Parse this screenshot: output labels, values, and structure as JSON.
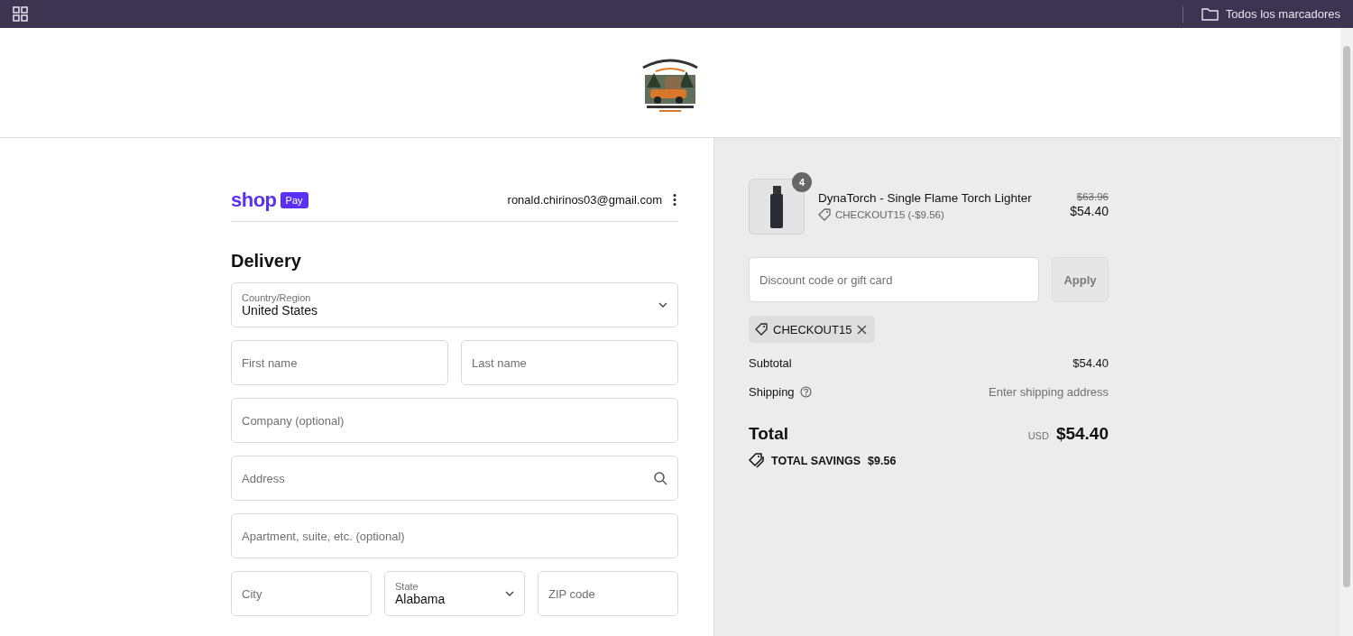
{
  "browser_bar": {
    "bookmarks_label": "Todos los marcadores"
  },
  "shop_pay": {
    "brand": "shop",
    "badge": "Pay",
    "email": "ronald.chirinos03@gmail.com"
  },
  "delivery": {
    "heading": "Delivery",
    "rows": [
      [
        {
          "kind": "select",
          "label": "Country/Region",
          "value": "United States"
        }
      ],
      [
        {
          "kind": "text",
          "placeholder": "First name"
        },
        {
          "kind": "text",
          "placeholder": "Last name"
        }
      ],
      [
        {
          "kind": "text",
          "placeholder": "Company (optional)"
        }
      ],
      [
        {
          "kind": "search",
          "placeholder": "Address"
        }
      ],
      [
        {
          "kind": "text",
          "placeholder": "Apartment, suite, etc. (optional)"
        }
      ],
      [
        {
          "kind": "text",
          "placeholder": "City"
        },
        {
          "kind": "select",
          "label": "State",
          "value": "Alabama"
        },
        {
          "kind": "text",
          "placeholder": "ZIP code"
        }
      ]
    ]
  },
  "summary": {
    "item": {
      "quantity": "4",
      "name": "DynaTorch - Single Flame Torch Lighter",
      "discount": "CHECKOUT15 (-$9.56)",
      "original_price": "$63.96",
      "price": "$54.40"
    },
    "discount_field": {
      "placeholder": "Discount code or gift card"
    },
    "apply_button": {
      "label": "Apply",
      "disabled": true
    },
    "applied_codes": [
      {
        "code": "CHECKOUT15"
      }
    ],
    "lines": [
      {
        "kind": "amount",
        "label": "Subtotal",
        "value": "$54.40"
      },
      {
        "kind": "pending",
        "label": "Shipping",
        "value": "Enter shipping address"
      }
    ],
    "total": {
      "label": "Total",
      "currency": "USD",
      "amount": "$54.40"
    },
    "savings": {
      "label": "TOTAL SAVINGS",
      "amount": "$9.56"
    }
  }
}
